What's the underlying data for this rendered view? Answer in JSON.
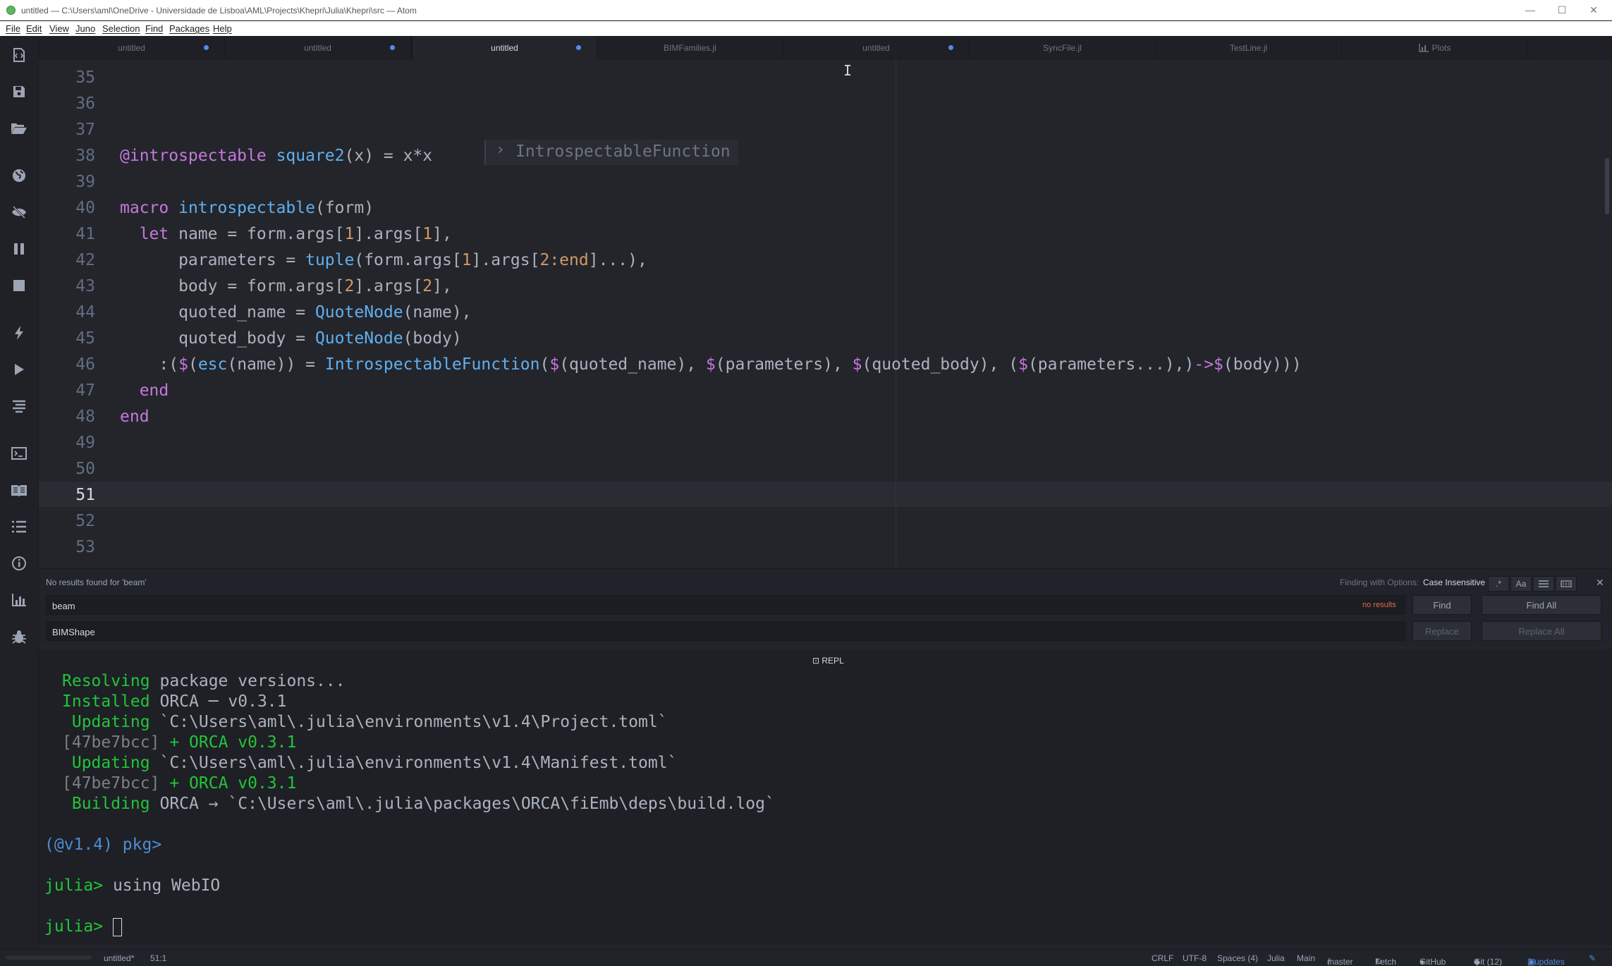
{
  "window": {
    "title": "untitled — C:\\Users\\aml\\OneDrive - Universidade de Lisboa\\AML\\Projects\\Khepri\\Julia\\Khepri\\src — Atom",
    "minimize": "—",
    "maximize": "☐",
    "close": "✕"
  },
  "menu": [
    "File",
    "Edit",
    "View",
    "Juno",
    "Selection",
    "Find",
    "Packages",
    "Help"
  ],
  "sidebar_icons": [
    "juno-icon",
    "save-icon",
    "open-folder-icon",
    "globe-icon",
    "eye-off-icon",
    "pause-icon",
    "stop-icon",
    "bolt-icon",
    "play-icon",
    "format-icon",
    "terminal-icon",
    "book-icon",
    "list-icon",
    "info-icon",
    "plots-icon",
    "debug-icon"
  ],
  "tabs": [
    {
      "label": "untitled",
      "modified": true,
      "active": false
    },
    {
      "label": "untitled",
      "modified": true,
      "active": false
    },
    {
      "label": "untitled",
      "modified": true,
      "active": true
    },
    {
      "label": "BIMFamilies.jl",
      "modified": false,
      "active": false
    },
    {
      "label": "untitled",
      "modified": true,
      "active": false
    },
    {
      "label": "SyncFile.jl",
      "modified": false,
      "active": false
    },
    {
      "label": "TestLine.jl",
      "modified": false,
      "active": false
    },
    {
      "label": "Plots",
      "modified": false,
      "active": false
    }
  ],
  "editor": {
    "line_numbers": [
      "35",
      "36",
      "37",
      "38",
      "39",
      "40",
      "41",
      "42",
      "43",
      "44",
      "45",
      "46",
      "47",
      "48",
      "49",
      "50",
      "51",
      "52",
      "53"
    ],
    "current_line": "51",
    "inline_result": "IntrospectableFunction",
    "code": {
      "l38_a": "@introspectable",
      "l38_b": " square2",
      "l38_c": "(x) = x*x",
      "l40_a": "macro",
      "l40_b": " introspectable",
      "l40_c": "(form)",
      "l41_a": "  let",
      "l41_b": " name = form.args[",
      "l41_n1": "1",
      "l41_c": "].args[",
      "l41_n2": "1",
      "l41_d": "],",
      "l42_a": "      parameters = ",
      "l42_b": "tuple",
      "l42_c": "(form.args[",
      "l42_n1": "1",
      "l42_d": "].args[",
      "l42_n2": "2:end",
      "l42_e": "]...),",
      "l43_a": "      body = form.args[",
      "l43_n1": "2",
      "l43_b": "].args[",
      "l43_n2": "2",
      "l43_c": "],",
      "l44_a": "      quoted_name = ",
      "l44_b": "QuoteNode",
      "l44_c": "(name),",
      "l45_a": "      quoted_body = ",
      "l45_b": "QuoteNode",
      "l45_c": "(body)",
      "l46_a": "    :(",
      "l46_d1": "$",
      "l46_b": "(",
      "l46_c": "esc",
      "l46_d": "(name)) = ",
      "l46_e": "IntrospectableFunction",
      "l46_f": "(",
      "l46_d2": "$",
      "l46_g": "(quoted_name), ",
      "l46_d3": "$",
      "l46_h": "(parameters), ",
      "l46_d4": "$",
      "l46_i": "(quoted_body), (",
      "l46_d5": "$",
      "l46_j": "(parameters...),)",
      "l46_k": "->",
      "l46_d6": "$",
      "l46_l": "(body)))",
      "l47": "  end",
      "l48": "end"
    }
  },
  "find": {
    "status": "No results found for 'beam'",
    "options_label": "Finding with Options:",
    "options_value": "Case Insensitive",
    "find_value": "beam",
    "replace_value": "BIMShape",
    "no_results": "no results",
    "find_btn": "Find",
    "find_all_btn": "Find All",
    "replace_btn": "Replace",
    "replace_all_btn": "Replace All",
    "opt_regex": ".*",
    "opt_case": "Aa",
    "close": "✕"
  },
  "repl": {
    "header": "REPL",
    "lines": {
      "r1a": "Resolving",
      "r1b": " package versions...",
      "r2a": "Installed",
      "r2b": " ORCA ─ v0.3.1",
      "r3a": " Updating",
      "r3b": " `C:\\Users\\aml\\.julia\\environments\\v1.4\\Project.toml`",
      "r4a": "[47be7bcc]",
      "r4b": " + ORCA v0.3.1",
      "r5a": " Updating",
      "r5b": " `C:\\Users\\aml\\.julia\\environments\\v1.4\\Manifest.toml`",
      "r6a": "[47be7bcc]",
      "r6b": " + ORCA v0.3.1",
      "r7a": " Building",
      "r7b": " ORCA → `C:\\Users\\aml\\.julia\\packages\\ORCA\\fiEmb\\deps\\build.log`",
      "r8": "(@v1.4) pkg>",
      "r9a": "julia>",
      "r9b": " using WebIO",
      "r10": "julia>"
    }
  },
  "status": {
    "file": "untitled*",
    "position": "51:1",
    "line_ending": "CRLF",
    "encoding": "UTF-8",
    "indent": "Spaces (4)",
    "grammar": "Julia",
    "module": "Main",
    "branch": "master",
    "fetch": "Fetch",
    "github": "GitHub",
    "git": "Git (12)",
    "updates": "3 updates"
  }
}
